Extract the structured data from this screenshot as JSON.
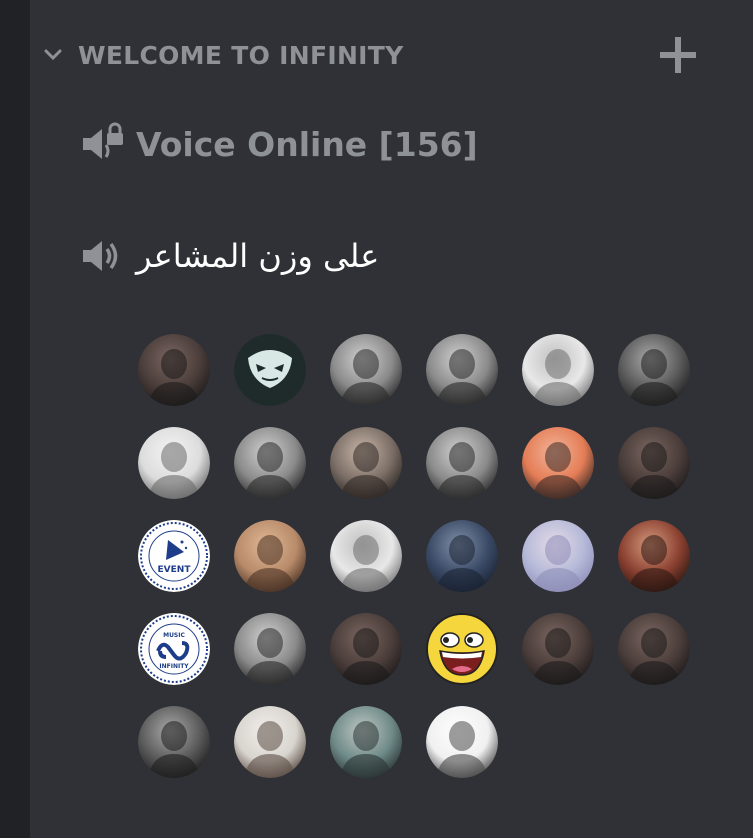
{
  "category": {
    "name": "WELCOME TO INFINITY"
  },
  "channels": [
    {
      "name": "Voice Online [156]",
      "type": "voice-locked",
      "icon": "speaker-lock-icon"
    },
    {
      "name": "على وزن المشاعر",
      "type": "voice",
      "icon": "speaker-icon"
    }
  ],
  "colors": {
    "sidebar_bg": "#2f3136",
    "server_strip_bg": "#202225",
    "muted_text": "#8e9297",
    "active_text": "#ffffff",
    "awesome_face_yellow": "#f5d63d"
  },
  "members": [
    {
      "avatar": "photo-dark"
    },
    {
      "avatar": "logo-mask"
    },
    {
      "avatar": "photo-bw-man"
    },
    {
      "avatar": "photo-bw-man"
    },
    {
      "avatar": "photo-light-woman"
    },
    {
      "avatar": "photo-bw-woman"
    },
    {
      "avatar": "photo-white-hoodie"
    },
    {
      "avatar": "photo-bw-man"
    },
    {
      "avatar": "photo-sepia-man"
    },
    {
      "avatar": "photo-bw-man"
    },
    {
      "avatar": "photo-orange-face"
    },
    {
      "avatar": "photo-dark"
    },
    {
      "avatar": "logo-event"
    },
    {
      "avatar": "photo-warm-woman"
    },
    {
      "avatar": "photo-light-woman"
    },
    {
      "avatar": "photo-dark-blue"
    },
    {
      "avatar": "photo-pastel"
    },
    {
      "avatar": "photo-red-man"
    },
    {
      "avatar": "logo-music"
    },
    {
      "avatar": "photo-bw-man"
    },
    {
      "avatar": "photo-dark"
    },
    {
      "avatar": "awesome-face"
    },
    {
      "avatar": "photo-dark"
    },
    {
      "avatar": "photo-dark"
    },
    {
      "avatar": "photo-bw-woman"
    },
    {
      "avatar": "photo-light-man"
    },
    {
      "avatar": "photo-teal-woman"
    },
    {
      "avatar": "photo-shemagh"
    }
  ],
  "logos": {
    "event_label": "EVENT",
    "music_top": "MUSIC",
    "music_bottom": "INFINITY"
  }
}
